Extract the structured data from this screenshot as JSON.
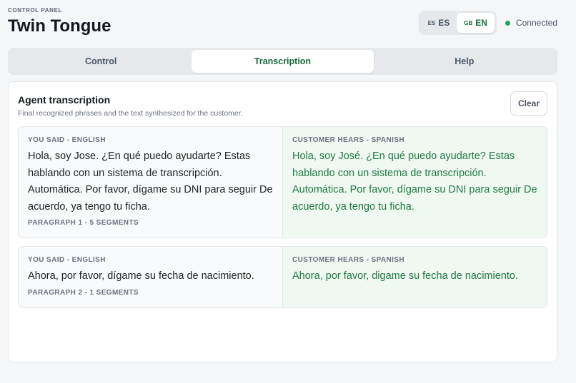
{
  "header": {
    "eyebrow": "CONTROL PANEL",
    "title": "Twin Tongue",
    "languages": [
      {
        "flag": "ES",
        "code": "ES",
        "active": false
      },
      {
        "flag": "GB",
        "code": "EN",
        "active": true
      }
    ],
    "status": "Connected",
    "status_color": "#22a35a"
  },
  "tabs": [
    {
      "label": "Control",
      "active": false
    },
    {
      "label": "Transcription",
      "active": true
    },
    {
      "label": "Help",
      "active": false
    }
  ],
  "panel": {
    "title": "Agent transcription",
    "subtitle": "Final recognized phrases and the text synthesized for the customer.",
    "clear_label": "Clear",
    "paragraphs": [
      {
        "left_label": "YOU SAID - ENGLISH",
        "left_text": "Hola, soy Jose. ¿En qué puedo ayudarte? Estas hablando con un sistema de transcripción. Automática. Por favor, dígame su DNI para seguir De acuerdo, ya tengo tu ficha.",
        "meta": "PARAGRAPH 1 - 5 SEGMENTS",
        "right_label": "CUSTOMER HEARS - SPANISH",
        "right_text": "Hola, soy José. ¿En qué puedo ayudarte? Estas hablando con un sistema de transcripción. Automática. Por favor, dígame su DNI para seguir De acuerdo, ya tengo tu ficha."
      },
      {
        "left_label": "YOU SAID - ENGLISH",
        "left_text": "Ahora, por favor, dígame su fecha de nacimiento.",
        "meta": "PARAGRAPH 2 - 1 SEGMENTS",
        "right_label": "CUSTOMER HEARS - SPANISH",
        "right_text": "Ahora, por favor, digame su fecha de nacimiento."
      }
    ]
  },
  "colors": {
    "accent": "#176b3a",
    "spanish_text": "#1f7a3f",
    "spanish_bg": "#f0f8f2"
  }
}
